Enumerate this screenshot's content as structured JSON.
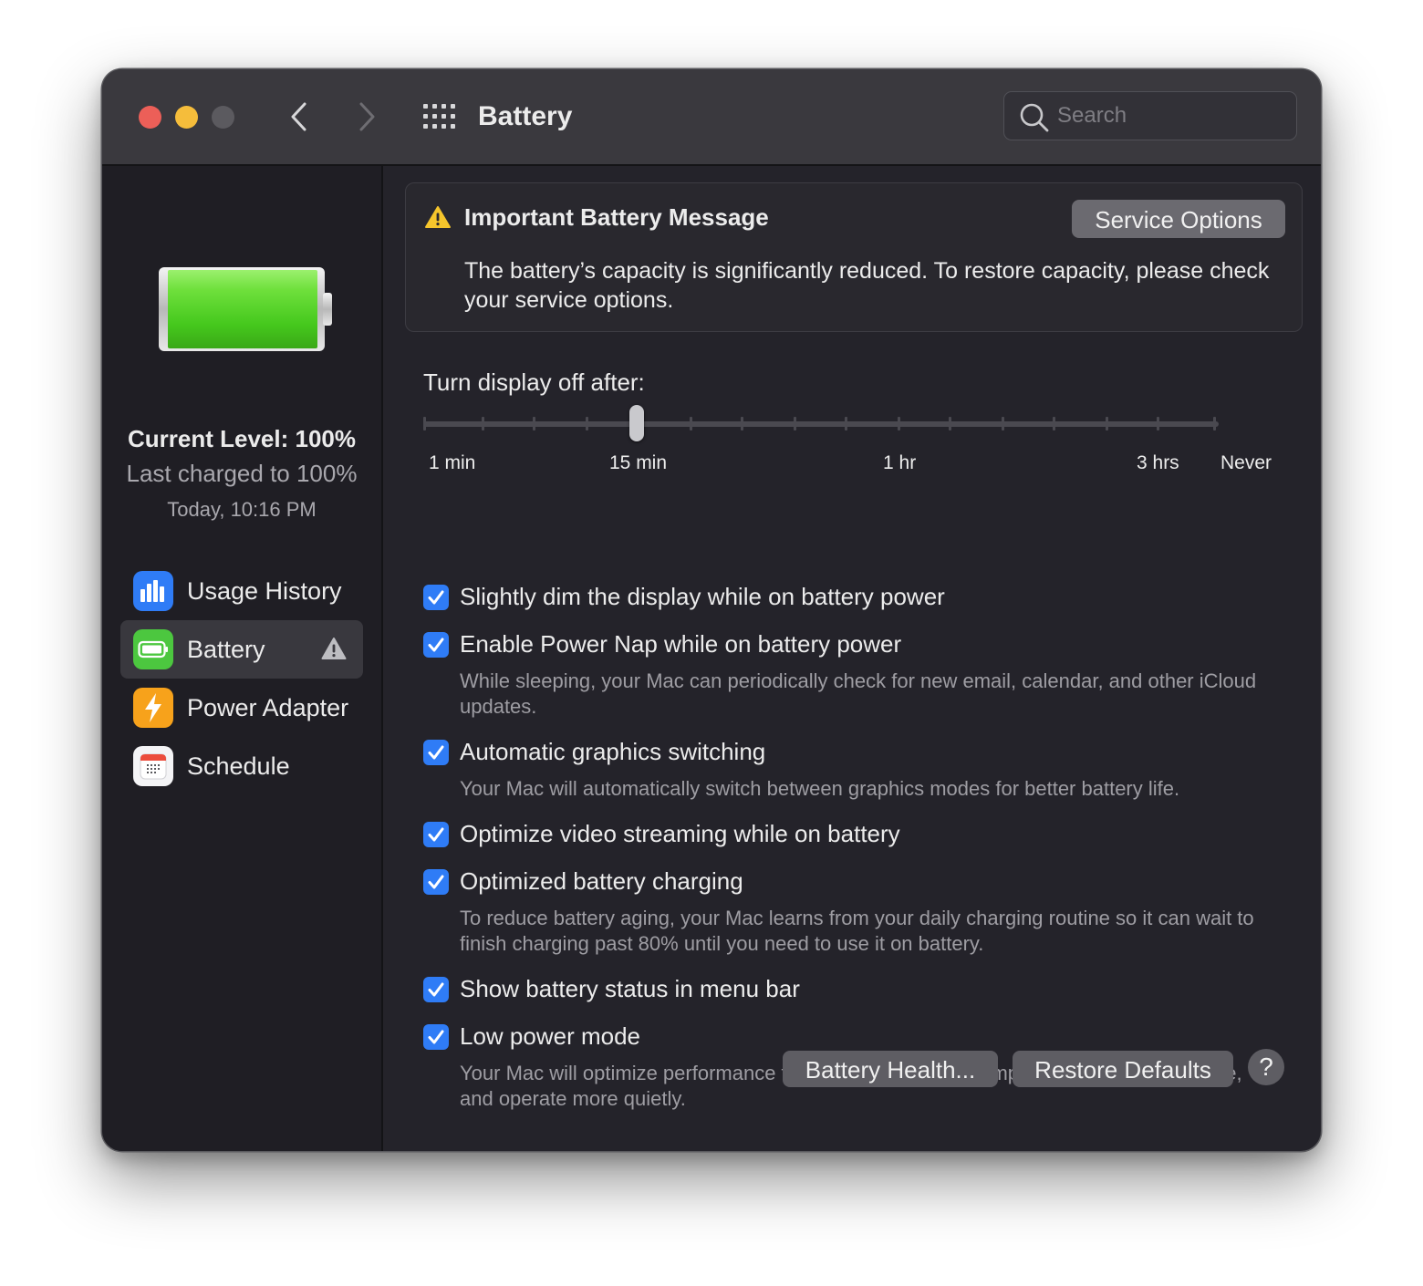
{
  "window": {
    "title": "Battery",
    "search_placeholder": "Search"
  },
  "sidebar": {
    "current_level": "Current Level: 100%",
    "last_charged": "Last charged to 100%",
    "charged_time": "Today, 10:16 PM",
    "items": [
      {
        "label": "Usage History",
        "icon": "bar-chart-icon",
        "color": "#2f7cf6"
      },
      {
        "label": "Battery",
        "icon": "battery-icon",
        "color": "#4cc73f",
        "selected": true,
        "warning": true
      },
      {
        "label": "Power Adapter",
        "icon": "lightning-icon",
        "color": "#f7a21b"
      },
      {
        "label": "Schedule",
        "icon": "calendar-icon",
        "color": "#ffffff"
      }
    ]
  },
  "message": {
    "title": "Important Battery Message",
    "text": "The battery’s capacity is significantly reduced. To restore capacity, please check your service options.",
    "button": "Service Options"
  },
  "display_off": {
    "label": "Turn display off after:",
    "tick_labels": [
      "1 min",
      "15 min",
      "1 hr",
      "3 hrs",
      "Never"
    ],
    "selected": "15 min"
  },
  "options": [
    {
      "label": "Slightly dim the display while on battery power",
      "checked": true
    },
    {
      "label": "Enable Power Nap while on battery power",
      "checked": true,
      "description": "While sleeping, your Mac can periodically check for new email, calendar, and other iCloud updates."
    },
    {
      "label": "Automatic graphics switching",
      "checked": true,
      "description": "Your Mac will automatically switch between graphics modes for better battery life."
    },
    {
      "label": "Optimize video streaming while on battery",
      "checked": true
    },
    {
      "label": "Optimized battery charging",
      "checked": true,
      "description": "To reduce battery aging, your Mac learns from your daily charging routine so it can wait to finish charging past 80% until you need to use it on battery."
    },
    {
      "label": "Show battery status in menu bar",
      "checked": true
    },
    {
      "label": "Low power mode",
      "checked": true,
      "description": "Your Mac will optimize performance to reduce energy consumption, increase battery life, and operate more quietly."
    }
  ],
  "buttons": {
    "battery_health": "Battery Health...",
    "restore_defaults": "Restore Defaults",
    "help": "?"
  },
  "colors": {
    "accent": "#2f7cf6",
    "warning": "#f5c52c",
    "battery_green": "#4cc73f"
  }
}
